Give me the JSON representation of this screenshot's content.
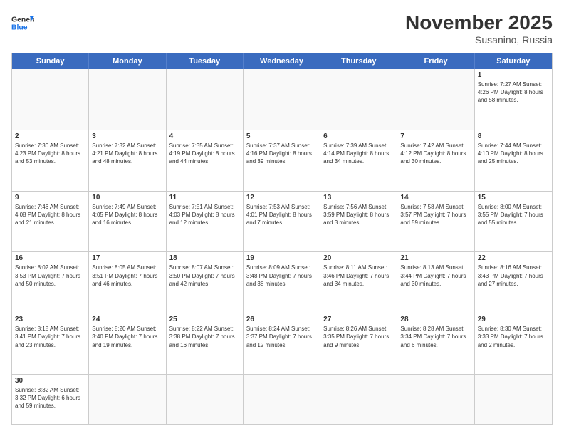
{
  "header": {
    "logo_general": "General",
    "logo_blue": "Blue",
    "month_title": "November 2025",
    "subtitle": "Susanino, Russia"
  },
  "weekdays": [
    "Sunday",
    "Monday",
    "Tuesday",
    "Wednesday",
    "Thursday",
    "Friday",
    "Saturday"
  ],
  "weeks": [
    [
      {
        "day": "",
        "empty": true,
        "content": ""
      },
      {
        "day": "",
        "empty": true,
        "content": ""
      },
      {
        "day": "",
        "empty": true,
        "content": ""
      },
      {
        "day": "",
        "empty": true,
        "content": ""
      },
      {
        "day": "",
        "empty": true,
        "content": ""
      },
      {
        "day": "",
        "empty": true,
        "content": ""
      },
      {
        "day": "1",
        "empty": false,
        "content": "Sunrise: 7:27 AM\nSunset: 4:26 PM\nDaylight: 8 hours\nand 58 minutes."
      }
    ],
    [
      {
        "day": "2",
        "empty": false,
        "content": "Sunrise: 7:30 AM\nSunset: 4:23 PM\nDaylight: 8 hours\nand 53 minutes."
      },
      {
        "day": "3",
        "empty": false,
        "content": "Sunrise: 7:32 AM\nSunset: 4:21 PM\nDaylight: 8 hours\nand 48 minutes."
      },
      {
        "day": "4",
        "empty": false,
        "content": "Sunrise: 7:35 AM\nSunset: 4:19 PM\nDaylight: 8 hours\nand 44 minutes."
      },
      {
        "day": "5",
        "empty": false,
        "content": "Sunrise: 7:37 AM\nSunset: 4:16 PM\nDaylight: 8 hours\nand 39 minutes."
      },
      {
        "day": "6",
        "empty": false,
        "content": "Sunrise: 7:39 AM\nSunset: 4:14 PM\nDaylight: 8 hours\nand 34 minutes."
      },
      {
        "day": "7",
        "empty": false,
        "content": "Sunrise: 7:42 AM\nSunset: 4:12 PM\nDaylight: 8 hours\nand 30 minutes."
      },
      {
        "day": "8",
        "empty": false,
        "content": "Sunrise: 7:44 AM\nSunset: 4:10 PM\nDaylight: 8 hours\nand 25 minutes."
      }
    ],
    [
      {
        "day": "9",
        "empty": false,
        "content": "Sunrise: 7:46 AM\nSunset: 4:08 PM\nDaylight: 8 hours\nand 21 minutes."
      },
      {
        "day": "10",
        "empty": false,
        "content": "Sunrise: 7:49 AM\nSunset: 4:05 PM\nDaylight: 8 hours\nand 16 minutes."
      },
      {
        "day": "11",
        "empty": false,
        "content": "Sunrise: 7:51 AM\nSunset: 4:03 PM\nDaylight: 8 hours\nand 12 minutes."
      },
      {
        "day": "12",
        "empty": false,
        "content": "Sunrise: 7:53 AM\nSunset: 4:01 PM\nDaylight: 8 hours\nand 7 minutes."
      },
      {
        "day": "13",
        "empty": false,
        "content": "Sunrise: 7:56 AM\nSunset: 3:59 PM\nDaylight: 8 hours\nand 3 minutes."
      },
      {
        "day": "14",
        "empty": false,
        "content": "Sunrise: 7:58 AM\nSunset: 3:57 PM\nDaylight: 7 hours\nand 59 minutes."
      },
      {
        "day": "15",
        "empty": false,
        "content": "Sunrise: 8:00 AM\nSunset: 3:55 PM\nDaylight: 7 hours\nand 55 minutes."
      }
    ],
    [
      {
        "day": "16",
        "empty": false,
        "content": "Sunrise: 8:02 AM\nSunset: 3:53 PM\nDaylight: 7 hours\nand 50 minutes."
      },
      {
        "day": "17",
        "empty": false,
        "content": "Sunrise: 8:05 AM\nSunset: 3:51 PM\nDaylight: 7 hours\nand 46 minutes."
      },
      {
        "day": "18",
        "empty": false,
        "content": "Sunrise: 8:07 AM\nSunset: 3:50 PM\nDaylight: 7 hours\nand 42 minutes."
      },
      {
        "day": "19",
        "empty": false,
        "content": "Sunrise: 8:09 AM\nSunset: 3:48 PM\nDaylight: 7 hours\nand 38 minutes."
      },
      {
        "day": "20",
        "empty": false,
        "content": "Sunrise: 8:11 AM\nSunset: 3:46 PM\nDaylight: 7 hours\nand 34 minutes."
      },
      {
        "day": "21",
        "empty": false,
        "content": "Sunrise: 8:13 AM\nSunset: 3:44 PM\nDaylight: 7 hours\nand 30 minutes."
      },
      {
        "day": "22",
        "empty": false,
        "content": "Sunrise: 8:16 AM\nSunset: 3:43 PM\nDaylight: 7 hours\nand 27 minutes."
      }
    ],
    [
      {
        "day": "23",
        "empty": false,
        "content": "Sunrise: 8:18 AM\nSunset: 3:41 PM\nDaylight: 7 hours\nand 23 minutes."
      },
      {
        "day": "24",
        "empty": false,
        "content": "Sunrise: 8:20 AM\nSunset: 3:40 PM\nDaylight: 7 hours\nand 19 minutes."
      },
      {
        "day": "25",
        "empty": false,
        "content": "Sunrise: 8:22 AM\nSunset: 3:38 PM\nDaylight: 7 hours\nand 16 minutes."
      },
      {
        "day": "26",
        "empty": false,
        "content": "Sunrise: 8:24 AM\nSunset: 3:37 PM\nDaylight: 7 hours\nand 12 minutes."
      },
      {
        "day": "27",
        "empty": false,
        "content": "Sunrise: 8:26 AM\nSunset: 3:35 PM\nDaylight: 7 hours\nand 9 minutes."
      },
      {
        "day": "28",
        "empty": false,
        "content": "Sunrise: 8:28 AM\nSunset: 3:34 PM\nDaylight: 7 hours\nand 6 minutes."
      },
      {
        "day": "29",
        "empty": false,
        "content": "Sunrise: 8:30 AM\nSunset: 3:33 PM\nDaylight: 7 hours\nand 2 minutes."
      }
    ],
    [
      {
        "day": "30",
        "empty": false,
        "content": "Sunrise: 8:32 AM\nSunset: 3:32 PM\nDaylight: 6 hours\nand 59 minutes."
      },
      {
        "day": "",
        "empty": true,
        "content": ""
      },
      {
        "day": "",
        "empty": true,
        "content": ""
      },
      {
        "day": "",
        "empty": true,
        "content": ""
      },
      {
        "day": "",
        "empty": true,
        "content": ""
      },
      {
        "day": "",
        "empty": true,
        "content": ""
      },
      {
        "day": "",
        "empty": true,
        "content": ""
      }
    ]
  ]
}
